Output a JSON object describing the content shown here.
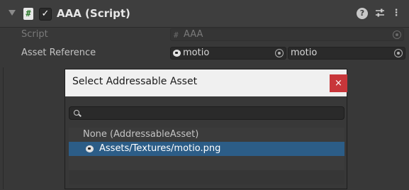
{
  "component": {
    "title": "AAA (Script)",
    "enabled": true,
    "icons": [
      "script-icon",
      "help-icon",
      "preset-icon",
      "more-menu-icon"
    ]
  },
  "script_row": {
    "label": "Script",
    "value": "AAA"
  },
  "asset_row": {
    "label": "Asset Reference",
    "value": "motio",
    "sub_value": "motio"
  },
  "dialog": {
    "title": "Select Addressable Asset",
    "close_label": "×",
    "search_value": "",
    "items": [
      {
        "label": "None (AddressableAsset)",
        "selected": false
      },
      {
        "label": "Assets/Textures/motio.png",
        "selected": true
      }
    ]
  },
  "colors": {
    "selection": "#2c5d87",
    "close_button": "#c8363a",
    "script_icon_glyph": "#2d7a2d"
  }
}
